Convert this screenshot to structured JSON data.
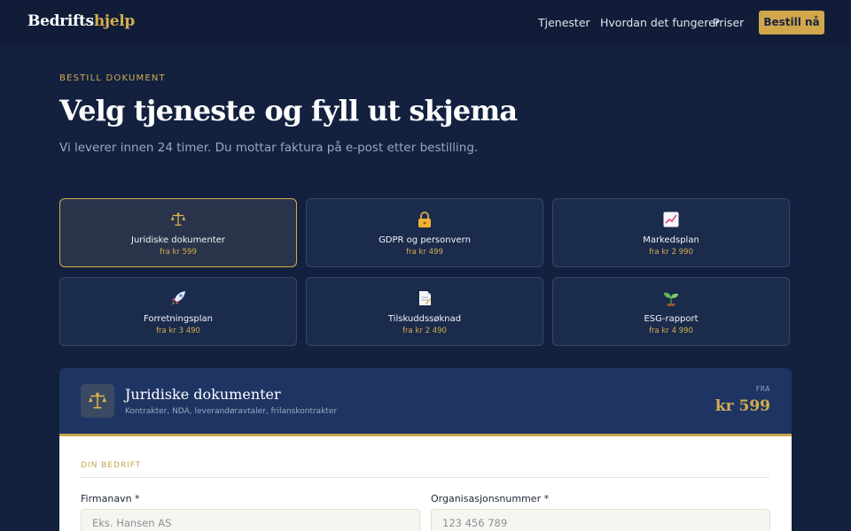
{
  "header": {
    "brand_main": "Bedrifts",
    "brand_accent": "hjelp",
    "nav": [
      "Tjenester",
      "Hvordan det fungerer",
      "Priser"
    ],
    "cta": "Bestill nå"
  },
  "hero": {
    "eyebrow": "BESTILL DOKUMENT",
    "title": "Velg tjeneste og fyll ut skjema",
    "subtitle": "Vi leverer innen 24 timer. Du mottar faktura på e-post etter bestilling."
  },
  "services": [
    {
      "name": "Juridiske dokumenter",
      "price": "fra kr 599",
      "icon": "scales-icon",
      "selected": true
    },
    {
      "name": "GDPR og personvern",
      "price": "fra kr 499",
      "icon": "lock-icon",
      "selected": false
    },
    {
      "name": "Markedsplan",
      "price": "fra kr 2 990",
      "icon": "chart-icon",
      "selected": false
    },
    {
      "name": "Forretningsplan",
      "price": "fra kr 3 490",
      "icon": "rocket-icon",
      "selected": false
    },
    {
      "name": "Tilskuddssøknad",
      "price": "fra kr 2 490",
      "icon": "document-icon",
      "selected": false
    },
    {
      "name": "ESG-rapport",
      "price": "fra kr 4 990",
      "icon": "seedling-icon",
      "selected": false
    }
  ],
  "selected_panel": {
    "title": "Juridiske dokumenter",
    "subtitle": "Kontrakter, NDA, leverandøravtaler, frilanskontrakter",
    "price_prefix": "FRA",
    "price": "kr 599",
    "icon": "scales-icon"
  },
  "form": {
    "section_label": "DIN BEDRIFT",
    "company_label": "Firmanavn *",
    "company_placeholder": "Eks. Hansen AS",
    "orgnr_label": "Organisasjonsnummer *",
    "orgnr_placeholder": "123 456 789"
  },
  "colors": {
    "background": "#13213f",
    "accent": "#d4ad4d",
    "panel_header": "#1e3564"
  }
}
